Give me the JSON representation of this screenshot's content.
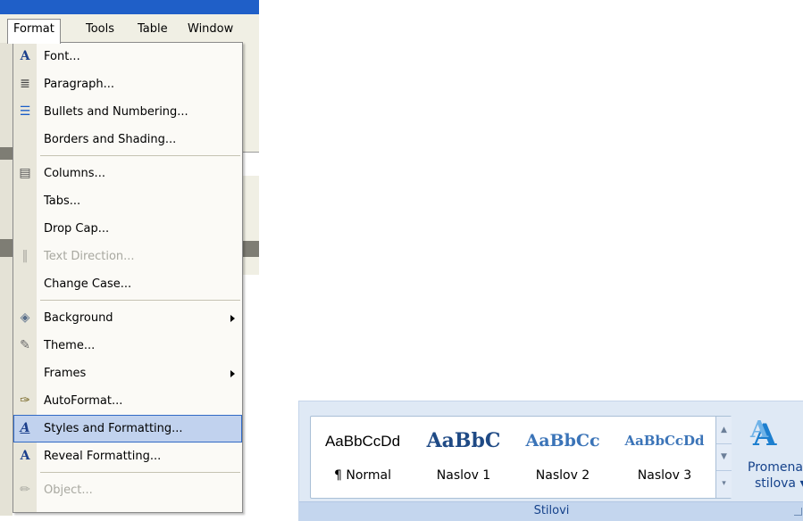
{
  "menubar": {
    "items": [
      "Format",
      "Tools",
      "Table",
      "Window"
    ],
    "active": "Format"
  },
  "format_menu": {
    "items": [
      {
        "label": "Font...",
        "icon": "font-icon",
        "glyph": "A",
        "enabled": true
      },
      {
        "label": "Paragraph...",
        "icon": "paragraph-icon",
        "glyph": "≣",
        "enabled": true
      },
      {
        "label": "Bullets and Numbering...",
        "icon": "bullets-icon",
        "glyph": "☰",
        "enabled": true
      },
      {
        "label": "Borders and Shading...",
        "icon": "",
        "glyph": "",
        "enabled": true
      },
      {
        "label": "Columns...",
        "icon": "columns-icon",
        "glyph": "▤",
        "enabled": true
      },
      {
        "label": "Tabs...",
        "icon": "",
        "glyph": "",
        "enabled": true
      },
      {
        "label": "Drop Cap...",
        "icon": "",
        "glyph": "",
        "enabled": true
      },
      {
        "label": "Text Direction...",
        "icon": "text-direction-icon",
        "glyph": "‖",
        "enabled": false
      },
      {
        "label": "Change Case...",
        "icon": "",
        "glyph": "",
        "enabled": true
      },
      {
        "label": "Background",
        "icon": "background-icon",
        "glyph": "◈",
        "enabled": true,
        "submenu": true
      },
      {
        "label": "Theme...",
        "icon": "theme-icon",
        "glyph": "✎",
        "enabled": true
      },
      {
        "label": "Frames",
        "icon": "",
        "glyph": "",
        "enabled": true,
        "submenu": true
      },
      {
        "label": "AutoFormat...",
        "icon": "autoformat-icon",
        "glyph": "✑",
        "enabled": true
      },
      {
        "label": "Styles and Formatting...",
        "icon": "styles-icon",
        "glyph": "A",
        "enabled": true,
        "highlighted": true
      },
      {
        "label": "Reveal Formatting...",
        "icon": "reveal-formatting-icon",
        "glyph": "A",
        "enabled": true
      },
      {
        "label": "Object...",
        "icon": "object-icon",
        "glyph": "✏",
        "enabled": false
      }
    ]
  },
  "ribbon": {
    "group_caption": "Stilovi",
    "styles": [
      {
        "sample": "AaBbCcDd",
        "name": "¶ Normal"
      },
      {
        "sample": "AaBbC",
        "name": "Naslov 1"
      },
      {
        "sample": "AaBbCc",
        "name": "Naslov 2"
      },
      {
        "sample": "AaBbCcDd",
        "name": "Naslov 3"
      }
    ],
    "change_styles": {
      "line1": "Promena",
      "line2": "stilova ▾"
    }
  },
  "colors": {
    "menu_highlight": "#c1d2ee",
    "ribbon_text": "#15428b",
    "heading_blue": "#1f5fa8"
  }
}
